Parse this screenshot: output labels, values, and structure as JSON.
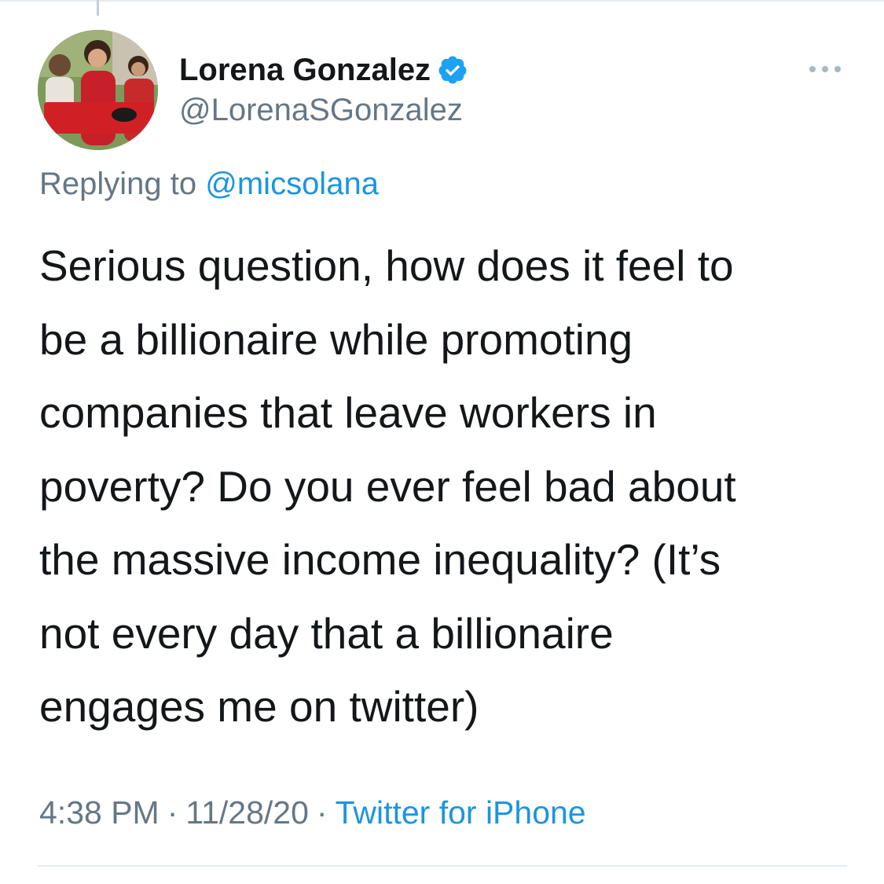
{
  "author": {
    "display_name": "Lorena Gonzalez",
    "handle": "@LorenaSGonzalez",
    "verified": true,
    "avatar_description_icon": "profile-photo"
  },
  "reply": {
    "prefix": "Replying to",
    "target": "@micsolana"
  },
  "tweet": {
    "lines": [
      "Serious question, how does it feel to",
      "be a billionaire while promoting",
      "companies that leave workers in",
      "poverty? Do you ever feel bad about",
      "the massive income inequality? (It’s",
      "not every day that a billionaire",
      "engages me on twitter)"
    ]
  },
  "meta": {
    "time": "4:38 PM",
    "separator": "·",
    "date": "11/28/20",
    "source": "Twitter for iPhone"
  },
  "icons": {
    "verified": "verified-badge-icon",
    "more": "more-options-icon"
  },
  "colors": {
    "text_primary": "#14171a",
    "text_secondary": "#657786",
    "link": "#1b95e0",
    "verified": "#1da1f2",
    "divider": "#e6ecf0"
  }
}
